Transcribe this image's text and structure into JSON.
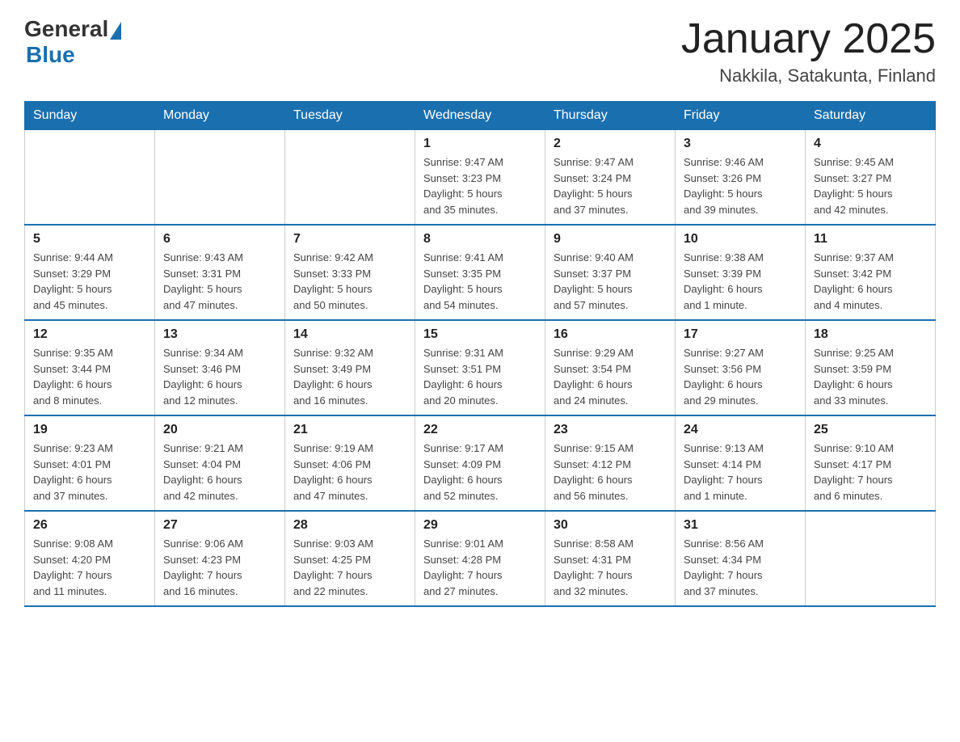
{
  "header": {
    "logo_general": "General",
    "logo_blue": "Blue",
    "month_title": "January 2025",
    "location": "Nakkila, Satakunta, Finland"
  },
  "days_of_week": [
    "Sunday",
    "Monday",
    "Tuesday",
    "Wednesday",
    "Thursday",
    "Friday",
    "Saturday"
  ],
  "weeks": [
    [
      {
        "day": "",
        "info": ""
      },
      {
        "day": "",
        "info": ""
      },
      {
        "day": "",
        "info": ""
      },
      {
        "day": "1",
        "info": "Sunrise: 9:47 AM\nSunset: 3:23 PM\nDaylight: 5 hours\nand 35 minutes."
      },
      {
        "day": "2",
        "info": "Sunrise: 9:47 AM\nSunset: 3:24 PM\nDaylight: 5 hours\nand 37 minutes."
      },
      {
        "day": "3",
        "info": "Sunrise: 9:46 AM\nSunset: 3:26 PM\nDaylight: 5 hours\nand 39 minutes."
      },
      {
        "day": "4",
        "info": "Sunrise: 9:45 AM\nSunset: 3:27 PM\nDaylight: 5 hours\nand 42 minutes."
      }
    ],
    [
      {
        "day": "5",
        "info": "Sunrise: 9:44 AM\nSunset: 3:29 PM\nDaylight: 5 hours\nand 45 minutes."
      },
      {
        "day": "6",
        "info": "Sunrise: 9:43 AM\nSunset: 3:31 PM\nDaylight: 5 hours\nand 47 minutes."
      },
      {
        "day": "7",
        "info": "Sunrise: 9:42 AM\nSunset: 3:33 PM\nDaylight: 5 hours\nand 50 minutes."
      },
      {
        "day": "8",
        "info": "Sunrise: 9:41 AM\nSunset: 3:35 PM\nDaylight: 5 hours\nand 54 minutes."
      },
      {
        "day": "9",
        "info": "Sunrise: 9:40 AM\nSunset: 3:37 PM\nDaylight: 5 hours\nand 57 minutes."
      },
      {
        "day": "10",
        "info": "Sunrise: 9:38 AM\nSunset: 3:39 PM\nDaylight: 6 hours\nand 1 minute."
      },
      {
        "day": "11",
        "info": "Sunrise: 9:37 AM\nSunset: 3:42 PM\nDaylight: 6 hours\nand 4 minutes."
      }
    ],
    [
      {
        "day": "12",
        "info": "Sunrise: 9:35 AM\nSunset: 3:44 PM\nDaylight: 6 hours\nand 8 minutes."
      },
      {
        "day": "13",
        "info": "Sunrise: 9:34 AM\nSunset: 3:46 PM\nDaylight: 6 hours\nand 12 minutes."
      },
      {
        "day": "14",
        "info": "Sunrise: 9:32 AM\nSunset: 3:49 PM\nDaylight: 6 hours\nand 16 minutes."
      },
      {
        "day": "15",
        "info": "Sunrise: 9:31 AM\nSunset: 3:51 PM\nDaylight: 6 hours\nand 20 minutes."
      },
      {
        "day": "16",
        "info": "Sunrise: 9:29 AM\nSunset: 3:54 PM\nDaylight: 6 hours\nand 24 minutes."
      },
      {
        "day": "17",
        "info": "Sunrise: 9:27 AM\nSunset: 3:56 PM\nDaylight: 6 hours\nand 29 minutes."
      },
      {
        "day": "18",
        "info": "Sunrise: 9:25 AM\nSunset: 3:59 PM\nDaylight: 6 hours\nand 33 minutes."
      }
    ],
    [
      {
        "day": "19",
        "info": "Sunrise: 9:23 AM\nSunset: 4:01 PM\nDaylight: 6 hours\nand 37 minutes."
      },
      {
        "day": "20",
        "info": "Sunrise: 9:21 AM\nSunset: 4:04 PM\nDaylight: 6 hours\nand 42 minutes."
      },
      {
        "day": "21",
        "info": "Sunrise: 9:19 AM\nSunset: 4:06 PM\nDaylight: 6 hours\nand 47 minutes."
      },
      {
        "day": "22",
        "info": "Sunrise: 9:17 AM\nSunset: 4:09 PM\nDaylight: 6 hours\nand 52 minutes."
      },
      {
        "day": "23",
        "info": "Sunrise: 9:15 AM\nSunset: 4:12 PM\nDaylight: 6 hours\nand 56 minutes."
      },
      {
        "day": "24",
        "info": "Sunrise: 9:13 AM\nSunset: 4:14 PM\nDaylight: 7 hours\nand 1 minute."
      },
      {
        "day": "25",
        "info": "Sunrise: 9:10 AM\nSunset: 4:17 PM\nDaylight: 7 hours\nand 6 minutes."
      }
    ],
    [
      {
        "day": "26",
        "info": "Sunrise: 9:08 AM\nSunset: 4:20 PM\nDaylight: 7 hours\nand 11 minutes."
      },
      {
        "day": "27",
        "info": "Sunrise: 9:06 AM\nSunset: 4:23 PM\nDaylight: 7 hours\nand 16 minutes."
      },
      {
        "day": "28",
        "info": "Sunrise: 9:03 AM\nSunset: 4:25 PM\nDaylight: 7 hours\nand 22 minutes."
      },
      {
        "day": "29",
        "info": "Sunrise: 9:01 AM\nSunset: 4:28 PM\nDaylight: 7 hours\nand 27 minutes."
      },
      {
        "day": "30",
        "info": "Sunrise: 8:58 AM\nSunset: 4:31 PM\nDaylight: 7 hours\nand 32 minutes."
      },
      {
        "day": "31",
        "info": "Sunrise: 8:56 AM\nSunset: 4:34 PM\nDaylight: 7 hours\nand 37 minutes."
      },
      {
        "day": "",
        "info": ""
      }
    ]
  ]
}
